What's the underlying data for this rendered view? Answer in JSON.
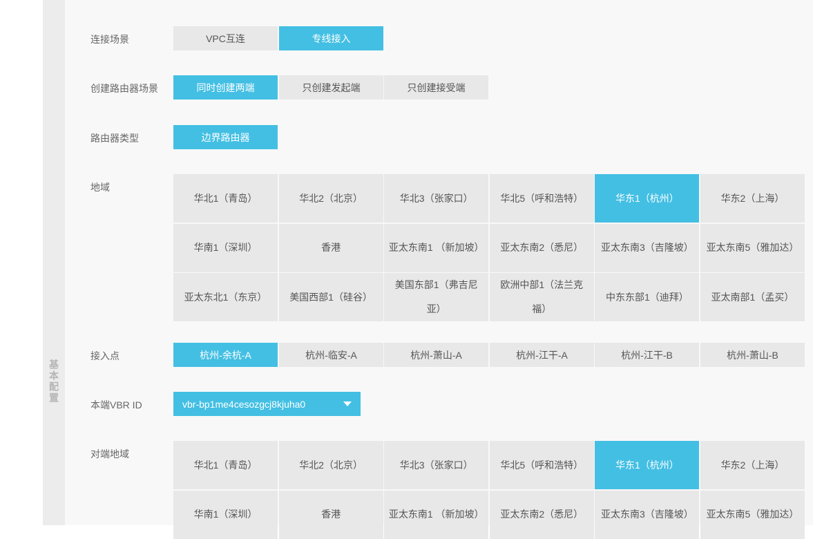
{
  "side_label": "基本配置",
  "connection_scene": {
    "label": "连接场景",
    "options": [
      "VPC互连",
      "专线接入"
    ],
    "selected": 1
  },
  "router_scene": {
    "label": "创建路由器场景",
    "options": [
      "同时创建两端",
      "只创建发起端",
      "只创建接受端"
    ],
    "selected": 0
  },
  "router_type": {
    "label": "路由器类型",
    "options": [
      "边界路由器"
    ],
    "selected": 0
  },
  "region": {
    "label": "地域",
    "options": [
      "华北1（青岛）",
      "华北2（北京）",
      "华北3（张家口）",
      "华北5（呼和浩特）",
      "华东1（杭州）",
      "华东2（上海）",
      "华南1（深圳）",
      "香港",
      "亚太东南1 （新加坡）",
      "亚太东南2（悉尼）",
      "亚太东南3（吉隆坡）",
      "亚太东南5（雅加达）",
      "亚太东北1（东京）",
      "美国西部1（硅谷）",
      "美国东部1（弗吉尼亚）",
      "欧洲中部1（法兰克福）",
      "中东东部1（迪拜）",
      "亚太南部1（孟买）"
    ],
    "selected": 4
  },
  "access_point": {
    "label": "接入点",
    "options": [
      "杭州-余杭-A",
      "杭州-临安-A",
      "杭州-萧山-A",
      "杭州-江干-A",
      "杭州-江干-B",
      "杭州-萧山-B"
    ],
    "selected": 0
  },
  "vbr": {
    "label": "本端VBR ID",
    "value": "vbr-bp1me4cesozgcj8kjuha0"
  },
  "peer_region": {
    "label": "对端地域",
    "options": [
      "华北1（青岛）",
      "华北2（北京）",
      "华北3（张家口）",
      "华北5（呼和浩特）",
      "华东1（杭州）",
      "华东2（上海）",
      "华南1（深圳）",
      "香港",
      "亚太东南1 （新加坡）",
      "亚太东南2（悉尼）",
      "亚太东南3（吉隆坡）",
      "亚太东南5（雅加达）"
    ],
    "selected": 4
  },
  "colors": {
    "accent": "#43bfe3",
    "option_bg": "#e8e8e8"
  }
}
